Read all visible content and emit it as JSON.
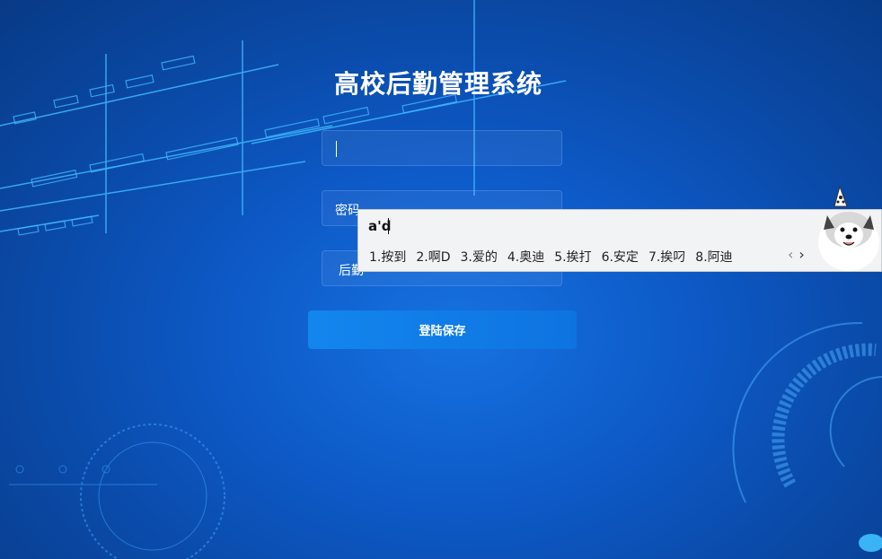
{
  "app": {
    "title": "高校后勤管理系统"
  },
  "form": {
    "username_value": "",
    "password_label": "密码",
    "role_label": "后勤",
    "login_button_label": "登陆保存"
  },
  "ime": {
    "composition": "a'd",
    "candidates": [
      "1.按到",
      "2.啊D",
      "3.爱的",
      "4.奥迪",
      "5.挨打",
      "6.安定",
      "7.挨叼",
      "8.阿迪"
    ],
    "prev_icon": "chevron-left-icon",
    "next_icon": "chevron-right-icon"
  },
  "colors": {
    "background": "#0d5ac8",
    "accent": "#1386ee",
    "text": "#ffffff",
    "ime_bg": "#f2f3f5"
  }
}
